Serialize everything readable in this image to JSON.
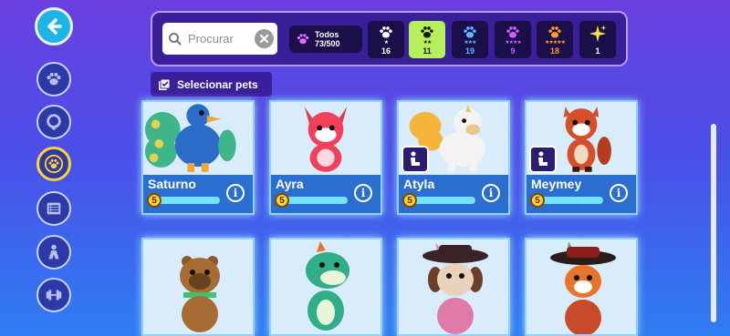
{
  "search": {
    "placeholder": "Procurar"
  },
  "all_filter": {
    "label": "Todos",
    "count": "73/500"
  },
  "rarity_filters": [
    {
      "stars": "★",
      "count": "16",
      "color": "#ffffff",
      "selected": false
    },
    {
      "stars": "★★",
      "count": "11",
      "color": "#1b1b1b",
      "selected": true
    },
    {
      "stars": "★★★",
      "count": "19",
      "color": "#5fb6ff",
      "selected": false
    },
    {
      "stars": "★★★★",
      "count": "9",
      "color": "#d05cff",
      "selected": false
    },
    {
      "stars": "★★★★★",
      "count": "18",
      "color": "#ff9a2e",
      "selected": false
    },
    {
      "stars": "",
      "count": "1",
      "color": "#ffe04a",
      "selected": false
    }
  ],
  "select_pets_label": "Selecionar pets",
  "pets": [
    {
      "name": "Saturno",
      "level": "5",
      "progress": 1.0
    },
    {
      "name": "Ayra",
      "level": "5",
      "progress": 1.0
    },
    {
      "name": "Atyla",
      "level": "5",
      "progress": 1.0
    },
    {
      "name": "Meymey",
      "level": "5",
      "progress": 1.0
    }
  ],
  "colors": {
    "accent": "#3a1f9a",
    "selected_rarity": "#b6f05a",
    "card_info": "#2a6fd0"
  }
}
